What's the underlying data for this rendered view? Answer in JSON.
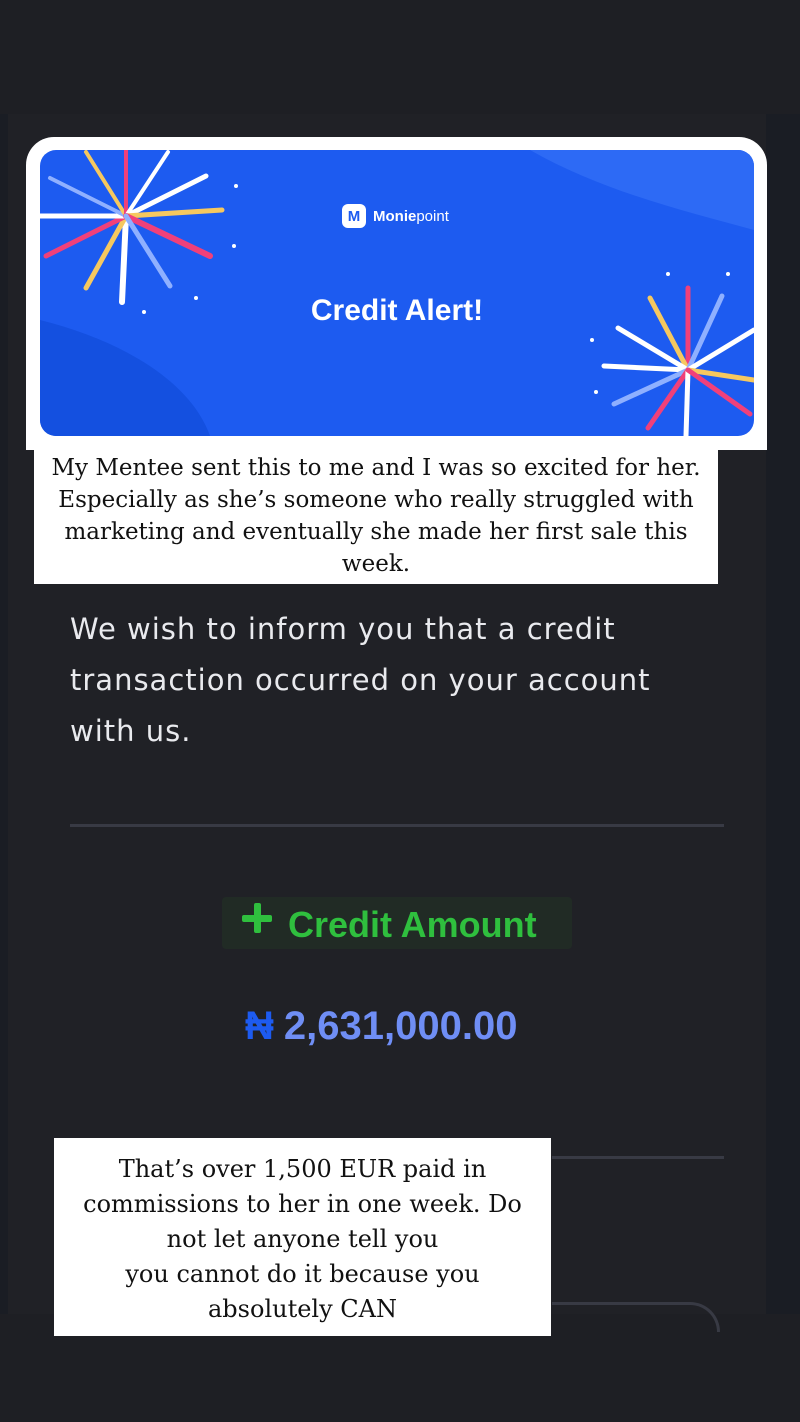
{
  "banner": {
    "logo_icon": "M",
    "logo_bold": "Monie",
    "logo_light": "point",
    "title": "Credit Alert!",
    "colors": {
      "blue": "#1d5bf0",
      "firework_pink": "#f0407a",
      "firework_yellow": "#f6c85f",
      "firework_white": "#ffffff"
    }
  },
  "caption_top": {
    "line1": "My Mentee sent this to me and I was so excited for her.",
    "line2": "Especially as she’s someone who really struggled with",
    "line3": "marketing and eventually she made her first sale this",
    "line4": "week."
  },
  "message": {
    "line1": "We wish to inform you that a credit",
    "line2": "transaction occurred on your account",
    "line3": "with us."
  },
  "credit": {
    "label": "Credit Amount",
    "currency_symbol": "₦",
    "amount": "2,631,000.00",
    "colors": {
      "label": "#2fbf3e",
      "amount": "#6f8ef5"
    }
  },
  "caption_bottom": {
    "line1": "That’s over 1,500 EUR paid in",
    "line2": "commissions to her in one week. Do",
    "line3": "not let anyone tell you",
    "line4": "you cannot do it because you",
    "line5": "absolutely CAN"
  }
}
